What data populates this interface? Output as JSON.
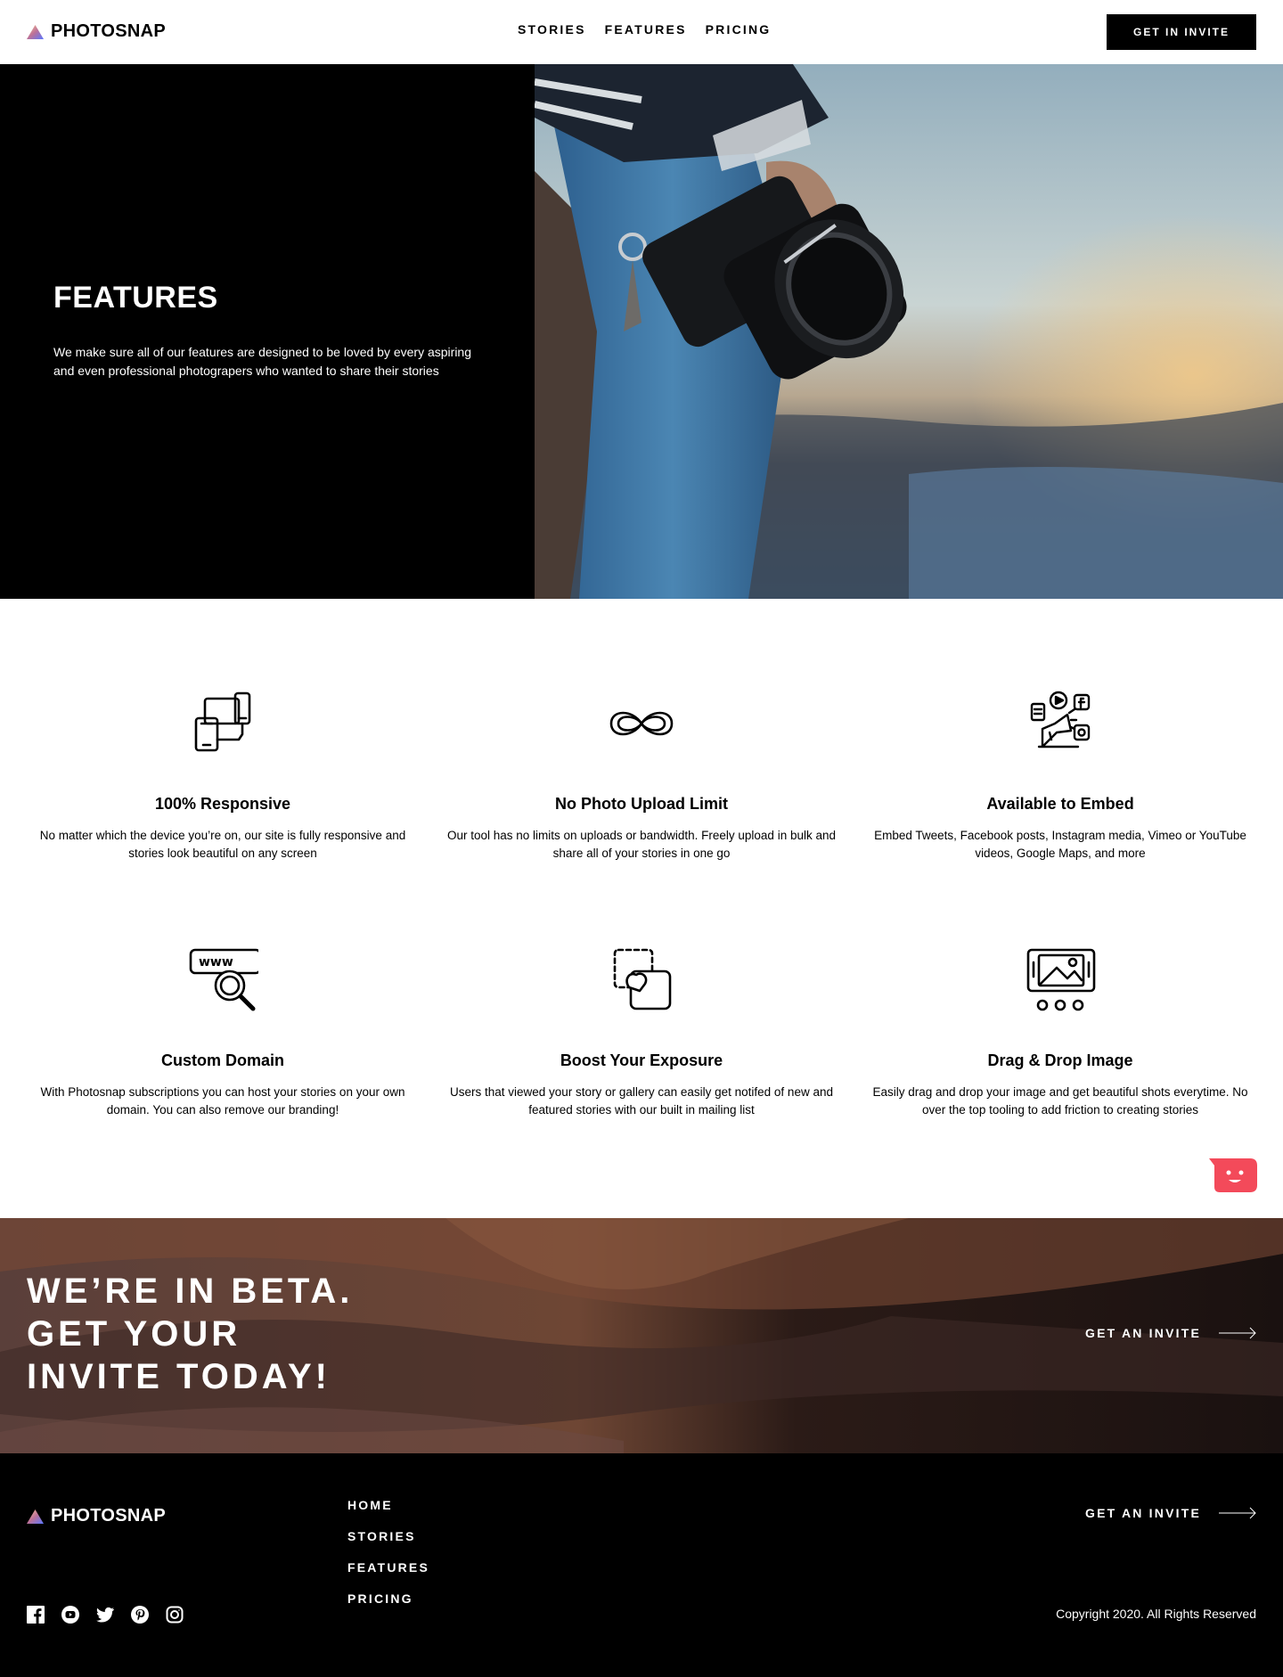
{
  "header": {
    "logo_text": "PHOTOSNAP",
    "nav": [
      "STORIES",
      "FEATURES",
      "PRICING"
    ],
    "cta_label": "GET IN INVITE"
  },
  "hero": {
    "title": "FEATURES",
    "text": "We make sure all of our features are designed to be loved by every aspiring and even professional photograpers who wanted to share their stories"
  },
  "features": [
    {
      "icon": "responsive-devices-icon",
      "title": "100% Responsive",
      "text": "No matter which the device you’re on, our site is fully responsive and stories look beautiful on any screen"
    },
    {
      "icon": "infinity-icon",
      "title": "No Photo Upload Limit",
      "text": "Our tool has no limits on uploads or bandwidth. Freely upload in bulk and share all of your stories in one go"
    },
    {
      "icon": "embed-media-icon",
      "title": "Available to Embed",
      "text": "Embed Tweets, Facebook posts, Instagram media, Vimeo or YouTube videos, Google Maps, and more"
    },
    {
      "icon": "custom-domain-icon",
      "title": "Custom Domain",
      "text": "With Photosnap subscriptions you can host your stories on your own domain. You can also remove our branding!"
    },
    {
      "icon": "boost-exposure-icon",
      "title": "Boost Your Exposure",
      "text": "Users that viewed your story or gallery can easily get notifed of new and featured stories with our built in mailing list"
    },
    {
      "icon": "drag-drop-image-icon",
      "title": "Drag & Drop Image",
      "text": "Easily drag and drop your image and get beautiful shots everytime. No over the top tooling to add friction to creating stories"
    }
  ],
  "beta": {
    "title_lines": [
      "WE’RE IN BETA.",
      "GET YOUR",
      "INVITE TODAY!"
    ],
    "link": "GET AN INVITE"
  },
  "footer": {
    "logo_text": "PHOTOSNAP",
    "nav": [
      "HOME",
      "STORIES",
      "FEATURES",
      "PRICING"
    ],
    "socials": [
      "facebook-icon",
      "youtube-icon",
      "twitter-icon",
      "pinterest-icon",
      "instagram-icon"
    ],
    "link": "GET AN INVITE",
    "copyright": "Copyright 2020. All Rights Reserved"
  },
  "colors": {
    "logo_gradient": [
      "#FFC593",
      "#BC7198",
      "#5A77FF"
    ],
    "chat_widget": "#F34A5A"
  }
}
